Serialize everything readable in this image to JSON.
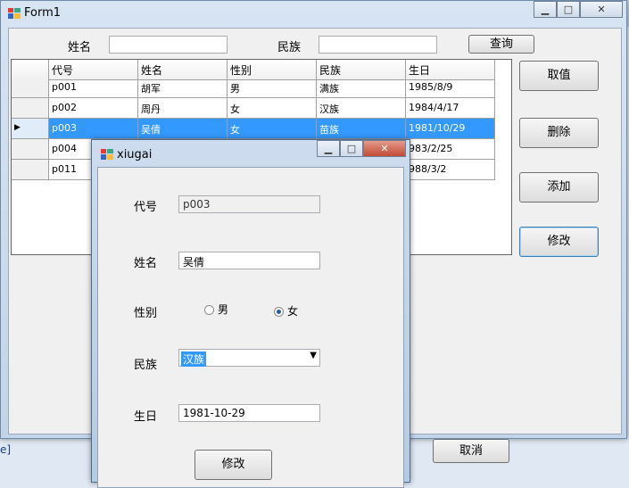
{
  "form1": {
    "title": "Form1",
    "search": {
      "name_label": "姓名",
      "name_value": "",
      "nation_label": "民族",
      "nation_value": "",
      "query_button": "查询"
    },
    "grid": {
      "columns": [
        "代号",
        "姓名",
        "性别",
        "民族",
        "生日"
      ],
      "rows": [
        {
          "code": "p001",
          "name": "胡军",
          "gender": "男",
          "nation": "满族",
          "birthday": "1985/8/9"
        },
        {
          "code": "p002",
          "name": "周丹",
          "gender": "女",
          "nation": "汉族",
          "birthday": "1984/4/17"
        },
        {
          "code": "p003",
          "name": "吴倩",
          "gender": "女",
          "nation": "苗族",
          "birthday": "1981/10/29"
        },
        {
          "code": "p004",
          "name": "",
          "gender": "",
          "nation": "",
          "birthday": "983/2/25"
        },
        {
          "code": "p011",
          "name": "",
          "gender": "",
          "nation": "",
          "birthday": "988/3/2"
        }
      ],
      "selected_row_marker": "▶"
    },
    "buttons": {
      "get_value": "取值",
      "delete": "删除",
      "add": "添加",
      "modify": "修改"
    },
    "cancel_button": "取消",
    "status_text": "e]"
  },
  "dialog": {
    "title": "xiugai",
    "code_label": "代号",
    "code_value": "p003",
    "name_label": "姓名",
    "name_value": "吴倩",
    "gender_label": "性别",
    "gender_options": [
      "男",
      "女"
    ],
    "gender_selected": "女",
    "nation_label": "民族",
    "nation_value": "汉族",
    "birthday_label": "生日",
    "birthday_value": "1981-10-29",
    "modify_button": "修改"
  }
}
